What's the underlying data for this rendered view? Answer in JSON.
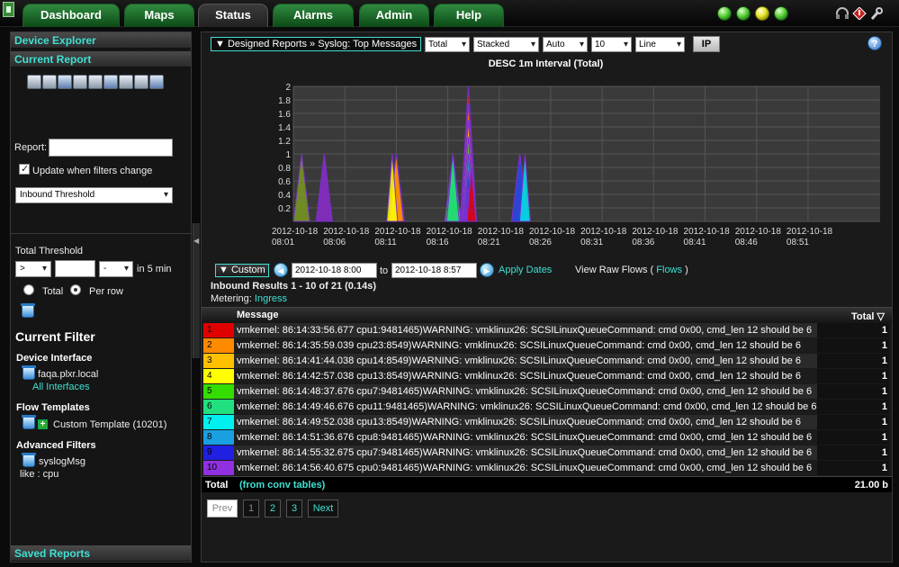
{
  "nav": {
    "tabs": [
      {
        "label": "Dashboard"
      },
      {
        "label": "Maps"
      },
      {
        "label": "Status"
      },
      {
        "label": "Alarms"
      },
      {
        "label": "Admin"
      },
      {
        "label": "Help"
      }
    ],
    "active_tab": "Status",
    "status_colors": [
      "#3ccf2a",
      "#3ccf2a",
      "#e6e62a",
      "#3ccf2a"
    ]
  },
  "sidebar": {
    "device_explorer": "Device Explorer",
    "current_report": "Current Report",
    "report_label": "Report:",
    "report_value": "",
    "update_checkbox_label": "Update when filters change",
    "report_type": "Inbound Threshold",
    "total_threshold": "Total Threshold",
    "operator": ">",
    "threshold_value": "",
    "unit": "-",
    "interval_text": "in 5 min",
    "radio_total": "Total",
    "radio_per_row": "Per row",
    "current_filter": "Current Filter",
    "device_interface_heading": "Device Interface",
    "device_name": "faqa.plxr.local",
    "all_interfaces": "All Interfaces",
    "flow_templates_heading": "Flow Templates",
    "custom_template": "Custom Template (10201)",
    "advanced_filters_heading": "Advanced Filters",
    "filter_name": "syslogMsg",
    "filter_value": "like : cpu",
    "saved_reports": "Saved Reports"
  },
  "toolbar": {
    "breadcrumb": "▼ Designed Reports » Syslog: Top Messages",
    "total": "Total",
    "stacked": "Stacked",
    "auto": "Auto",
    "count": "10",
    "line": "Line",
    "ip": "IP"
  },
  "chart_data": {
    "type": "area",
    "title": "DESC 1m Interval (Total)",
    "ylim": [
      0,
      2
    ],
    "y_ticks": [
      "2",
      "1.8",
      "1.6",
      "1.4",
      "1.2",
      "1",
      "0.8",
      "0.6",
      "0.4",
      "0.2"
    ],
    "x_ticks": [
      [
        "2012-10-18",
        "08:01"
      ],
      [
        "2012-10-18",
        "08:06"
      ],
      [
        "2012-10-18",
        "08:11"
      ],
      [
        "2012-10-18",
        "08:16"
      ],
      [
        "2012-10-18",
        "08:21"
      ],
      [
        "2012-10-18",
        "08:26"
      ],
      [
        "2012-10-18",
        "08:31"
      ],
      [
        "2012-10-18",
        "08:36"
      ],
      [
        "2012-10-18",
        "08:41"
      ],
      [
        "2012-10-18",
        "08:46"
      ],
      [
        "2012-10-18",
        "08:51"
      ]
    ],
    "grid": true,
    "series": [
      {
        "color": "#e00000",
        "peak_minute": 16.7,
        "value": 1
      },
      {
        "color": "#ff8a00",
        "peak_minute": 9.5,
        "value": 1
      },
      {
        "color": "#ffc000",
        "peak_minute": 10.0,
        "value": 1
      },
      {
        "color": "#ffff00",
        "peak_minute": 9.8,
        "value": 1
      },
      {
        "color": "#33cc33",
        "peak_minute": 15.5,
        "value": 1
      },
      {
        "color": "#20e080",
        "peak_minute": 17.3,
        "value": 1
      },
      {
        "color": "#00e5e5",
        "peak_minute": 22.5,
        "value": 1
      },
      {
        "color": "#1a9ad0",
        "peak_minute": 17.0,
        "value": 1
      },
      {
        "color": "#2f2fd8",
        "peak_minute": 22.0,
        "value": 1
      },
      {
        "color": "#8c2ad0",
        "peak_minute": 3.0,
        "value": 1
      }
    ],
    "stacked_spikes": [
      {
        "minute": 0.8,
        "value": 1,
        "color": "#7a9a20"
      },
      {
        "minute": 3.0,
        "value": 1,
        "color": "#8c2ad0"
      },
      {
        "minute": 10.0,
        "value": 1,
        "color": "#d8b000"
      },
      {
        "minute": 15.5,
        "value": 1,
        "color": "#33cc33"
      },
      {
        "minute": 17.0,
        "value": 2,
        "color": "#ffc000"
      },
      {
        "minute": 22.0,
        "value": 1,
        "color": "#00e5e5"
      }
    ]
  },
  "range": {
    "custom": "▼ Custom",
    "from": "2012-10-18 8:00",
    "to_label": "to",
    "to": "2012-10-18 8:57",
    "apply": "Apply Dates",
    "raw_flows_prefix": "View Raw Flows (",
    "raw_flows_link": "Flows",
    "raw_flows_suffix": ")"
  },
  "results": {
    "title": "Inbound Results 1 - 10 of 21 (0.14s)",
    "metering_label": "Metering:",
    "metering_value": "Ingress",
    "col_message": "Message",
    "col_total": "Total ▽",
    "rows": [
      {
        "rank": "1",
        "color": "#e00000",
        "message": "vmkernel: 86:14:33:56.677 cpu1:9481465)WARNING: vmklinux26: SCSILinuxQueueCommand: cmd 0x00, cmd_len 12 should be 6",
        "total": "1"
      },
      {
        "rank": "2",
        "color": "#ff8a00",
        "message": "vmkernel: 86:14:35:59.039 cpu23:8549)WARNING: vmklinux26: SCSILinuxQueueCommand: cmd 0x00, cmd_len 12 should be 6",
        "total": "1"
      },
      {
        "rank": "3",
        "color": "#ffc000",
        "message": "vmkernel: 86:14:41:44.038 cpu14:8549)WARNING: vmklinux26: SCSILinuxQueueCommand: cmd 0x00, cmd_len 12 should be 6",
        "total": "1"
      },
      {
        "rank": "4",
        "color": "#ffff00",
        "message": "vmkernel: 86:14:42:57.038 cpu13:8549)WARNING: vmklinux26: SCSILinuxQueueCommand: cmd 0x00, cmd_len 12 should be 6",
        "total": "1"
      },
      {
        "rank": "5",
        "color": "#33dd00",
        "message": "vmkernel: 86:14:48:37.676 cpu7:9481465)WARNING: vmklinux26: SCSILinuxQueueCommand: cmd 0x00, cmd_len 12 should be 6",
        "total": "1"
      },
      {
        "rank": "6",
        "color": "#20e080",
        "message": "vmkernel: 86:14:49:46.676 cpu11:9481465)WARNING: vmklinux26: SCSILinuxQueueCommand: cmd 0x00, cmd_len 12 should be 6",
        "total": "1"
      },
      {
        "rank": "7",
        "color": "#00f0f0",
        "message": "vmkernel: 86:14:49:52.038 cpu13:8549)WARNING: vmklinux26: SCSILinuxQueueCommand: cmd 0x00, cmd_len 12 should be 6",
        "total": "1"
      },
      {
        "rank": "8",
        "color": "#1aa0e0",
        "message": "vmkernel: 86:14:51:36.676 cpu8:9481465)WARNING: vmklinux26: SCSILinuxQueueCommand: cmd 0x00, cmd_len 12 should be 6",
        "total": "1"
      },
      {
        "rank": "9",
        "color": "#2020e0",
        "message": "vmkernel: 86:14:55:32.675 cpu7:9481465)WARNING: vmklinux26: SCSILinuxQueueCommand: cmd 0x00, cmd_len 12 should be 6",
        "total": "1"
      },
      {
        "rank": "10",
        "color": "#9030e0",
        "message": "vmkernel: 86:14:56:40.675 cpu0:9481465)WARNING: vmklinux26: SCSILinuxQueueCommand: cmd 0x00, cmd_len 12 should be 6",
        "total": "1"
      }
    ],
    "total_label": "Total",
    "total_source": "(from conv tables)",
    "total_value": "21.00 b"
  },
  "pager": {
    "prev": "Prev",
    "pages": [
      "1",
      "2",
      "3"
    ],
    "next": "Next"
  }
}
